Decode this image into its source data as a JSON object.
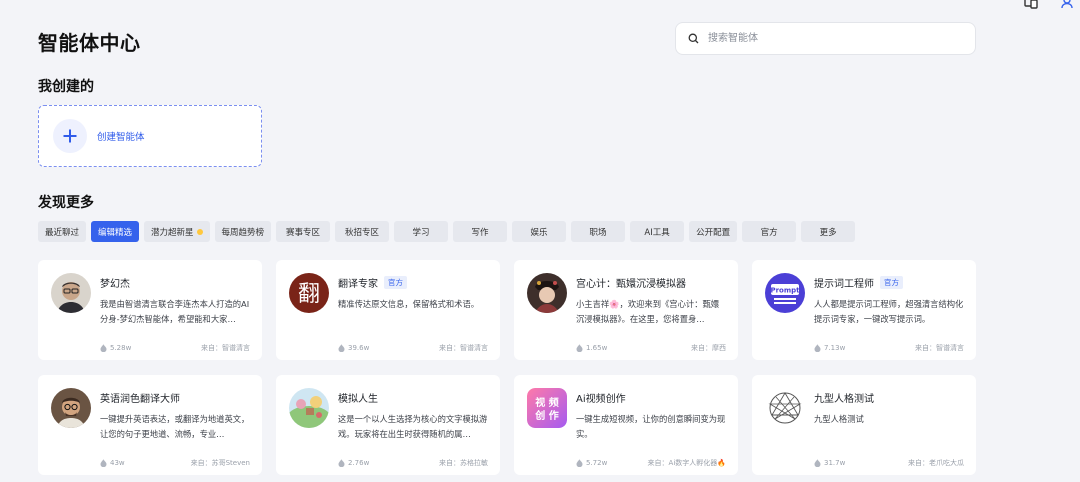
{
  "page": {
    "title": "智能体中心",
    "search_placeholder": "搜索智能体",
    "created_section": "我创建的",
    "create_label": "创建智能体",
    "discover_section": "发现更多"
  },
  "tabs": [
    "最近聊过",
    "编辑精选",
    "潜力超新星",
    "每周趋势榜",
    "赛事专区",
    "秋招专区",
    "学习",
    "写作",
    "娱乐",
    "职场",
    "AI工具",
    "公开配置",
    "官方",
    "更多"
  ],
  "active_tab": "编辑精选",
  "accent_color": "#3562ec",
  "cards": [
    {
      "name": "梦幻杰",
      "badge": "",
      "desc": "我是由智谱清言联合李连杰本人打造的AI分身-梦幻杰智能体，希望能和大家…",
      "uses": "5.28w",
      "source": "来自：智谱清言",
      "icon": "portrait-avatar"
    },
    {
      "name": "翻译专家",
      "badge": "官方",
      "desc": "精准传达原文信息，保留格式和术语。",
      "uses": "39.6w",
      "source": "来自：智谱清言",
      "icon": "fan-character-avatar"
    },
    {
      "name": "宫心计：甄嬛沉浸模拟器",
      "badge": "",
      "desc": "小主吉祥🌸，欢迎来到《宫心计：甄嬛沉浸模拟器》。在这里，您将置身…",
      "uses": "1.65w",
      "source": "来自：摩西",
      "icon": "empress-avatar"
    },
    {
      "name": "提示词工程师",
      "badge": "官方",
      "desc": "人人都是提示词工程师，超强清言结构化提示词专家，一键改写提示词。",
      "uses": "7.13w",
      "source": "来自：智谱清言",
      "icon": "prompt-avatar"
    },
    {
      "name": "英语润色翻译大师",
      "badge": "",
      "desc": "一键提升英语表达，或翻译为地道英文，让您的句子更地道、流畅，专业…",
      "uses": "43w",
      "source": "来自：苏哥Steven",
      "icon": "glasses-man-avatar"
    },
    {
      "name": "模拟人生",
      "badge": "",
      "desc": "这是一个以人生选择为核心的文字模拟游戏。玩家将在出生时获得随机的属…",
      "uses": "2.76w",
      "source": "来自：苏格拉敏",
      "icon": "landscape-avatar"
    },
    {
      "name": "Ai视频创作",
      "badge": "",
      "desc": "一键生成短视频，让你的创意瞬间变为现实。",
      "uses": "5.72w",
      "source": "来自：Ai数字人孵化器🔥",
      "icon": "video-avatar"
    },
    {
      "name": "九型人格测试",
      "badge": "",
      "desc": "九型人格测试",
      "uses": "31.7w",
      "source": "来自：老爪吃大瓜",
      "icon": "enneagram-avatar"
    }
  ]
}
